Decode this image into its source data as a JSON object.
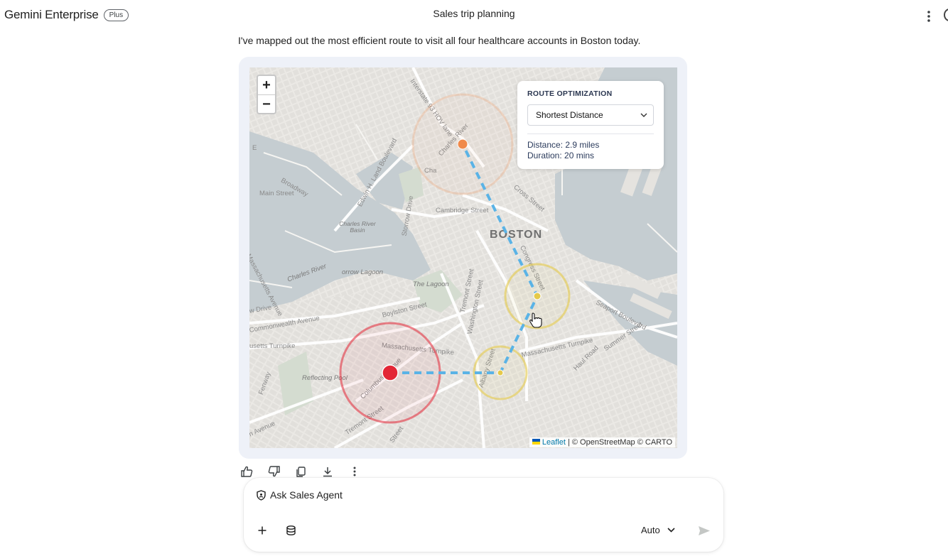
{
  "header": {
    "brand": "Gemini Enterprise",
    "plan_badge": "Plus",
    "chat_title": "Sales trip planning",
    "more_icon": "more-vert-icon"
  },
  "message": {
    "text": "I've mapped out the most efficient route to visit all four healthcare accounts in Boston today."
  },
  "map": {
    "zoom_in": "+",
    "zoom_out": "−",
    "city_label": "BOSTON",
    "route_panel": {
      "heading": "ROUTE OPTIMIZATION",
      "selected_option": "Shortest Distance",
      "distance": "Distance: 2.9 miles",
      "duration": "Duration: 20 mins"
    },
    "attribution": {
      "leaflet": "Leaflet",
      "rest": " | © OpenStreetMap © CARTO"
    },
    "labels": {
      "interstate": "Interstate 93 HOV lane",
      "charles_river_top": "Charles River",
      "broadway": "Broadway",
      "main_street": "Main Street",
      "edwin_land": "Edwin H. Land Boulevard",
      "storrow": "Storrow Drive",
      "cambridge_street": "Cambridge Street",
      "charles_basin": "Charles River Basin",
      "charles_river": "Charles River",
      "mass_ave": "Massachusetts Avenue",
      "storrow_lagoon": "orrow Lagoon",
      "the_lagoon": "The Lagoon",
      "boylston": "Boylston Street",
      "tremont": "Tremont Street",
      "washington": "Washington Street",
      "congress": "Congress Street",
      "cross_street": "Cross Street",
      "seaport": "Seaport Boulevard",
      "commonwealth": "Commonwealth Avenue",
      "drive": "w Drive",
      "turnpike_left": "usetts Turnpike",
      "turnpike_mid": "Massachusetts Turnpike",
      "turnpike_right": "Massachusetts Turnpike",
      "summer": "Summer Street",
      "haul_road": "Haul Road",
      "albany": "Albany Street",
      "reflecting_pool": "Reflecting Pool",
      "columbus": "Columbus Avenue",
      "tremont_low": "Tremont Street",
      "fenway": "Fenway",
      "avenue": "n Avenue",
      "street_low": "Street",
      "e_street": "E",
      "cha": "Cha"
    },
    "colors": {
      "water": "#c6cfd3",
      "land": "#eceae6",
      "route": "#5ab3e6",
      "stop_red": "#e32636",
      "stop_orange": "#f08a4b",
      "stop_yellow": "#e5c94a"
    }
  },
  "actions": {
    "thumbs_up_icon": "thumbs-up-icon",
    "thumbs_down_icon": "thumbs-down-icon",
    "copy_icon": "copy-icon",
    "download_icon": "download-icon",
    "more_icon": "more-vert-icon"
  },
  "composer": {
    "agent_label": "Ask Sales Agent",
    "model_selector": "Auto",
    "add_icon": "plus-icon",
    "data_icon": "database-icon",
    "send_icon": "send-icon"
  }
}
